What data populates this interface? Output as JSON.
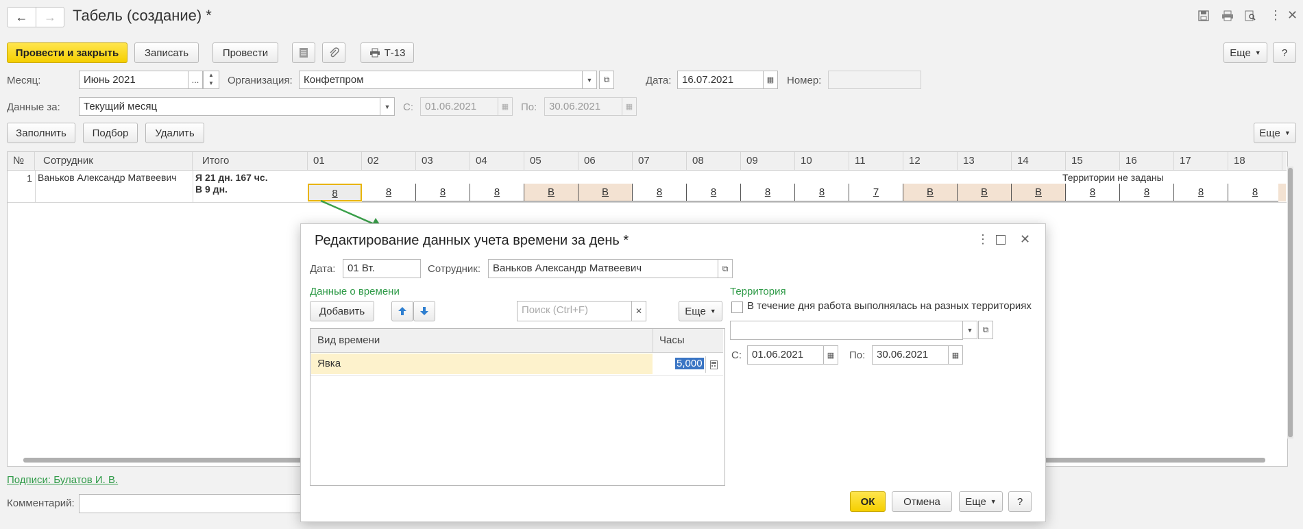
{
  "window": {
    "title": "Табель (создание) *"
  },
  "toolbar": {
    "post_close": "Провести и закрыть",
    "save": "Записать",
    "post": "Провести",
    "t13": "Т-13",
    "more": "Еще"
  },
  "header": {
    "month_label": "Месяц:",
    "month_value": "Июнь 2021",
    "org_label": "Организация:",
    "org_value": "Конфетпром",
    "date_label": "Дата:",
    "date_value": "16.07.2021",
    "number_label": "Номер:",
    "number_value": "",
    "data_for_label": "Данные за:",
    "data_for_value": "Текущий месяц",
    "from_label": "С:",
    "from_value": "01.06.2021",
    "to_label": "По:",
    "to_value": "30.06.2021"
  },
  "table_actions": {
    "fill": "Заполнить",
    "select": "Подбор",
    "delete": "Удалить",
    "more": "Еще"
  },
  "grid": {
    "headers": {
      "num": "№",
      "employee": "Сотрудник",
      "total": "Итого"
    },
    "days": [
      "01",
      "02",
      "03",
      "04",
      "05",
      "06",
      "07",
      "08",
      "09",
      "10",
      "11",
      "12",
      "13",
      "14",
      "15",
      "16",
      "17",
      "18"
    ],
    "row": {
      "num": "1",
      "employee": "Ваньков Александр Матвеевич",
      "total_line1": "Я 21 дн. 167 чс.",
      "total_line2": "В 9 дн.",
      "territory_note": "Территории не заданы",
      "values": [
        "8",
        "8",
        "8",
        "8",
        "В",
        "В",
        "8",
        "8",
        "8",
        "8",
        "7",
        "В",
        "В",
        "В",
        "8",
        "8",
        "8",
        "8"
      ]
    }
  },
  "footer": {
    "signatures": "Подписи: Булатов И. В.",
    "comment_label": "Комментарий:"
  },
  "dialog": {
    "title": "Редактирование данных учета времени за день *",
    "date_label": "Дата:",
    "date_value": "01 Вт.",
    "employee_label": "Сотрудник:",
    "employee_value": "Ваньков Александр Матвеевич",
    "time_data_header": "Данные о времени",
    "add": "Добавить",
    "search_placeholder": "Поиск (Ctrl+F)",
    "more": "Еще",
    "col_type": "Вид времени",
    "col_hours": "Часы",
    "row_type": "Явка",
    "row_hours": "5,000",
    "territory_header": "Территория",
    "territory_checkbox": "В течение дня работа выполнялась на разных территориях",
    "from_label": "С:",
    "from_value": "01.06.2021",
    "to_label": "По:",
    "to_value": "30.06.2021",
    "ok": "ОК",
    "cancel": "Отмена",
    "more_bottom": "Еще"
  },
  "colors": {
    "accent_yellow": "#f5cf00",
    "link_green": "#2e9a47",
    "weekend": "#f3e2d2",
    "arrow": "#3aa04a"
  }
}
